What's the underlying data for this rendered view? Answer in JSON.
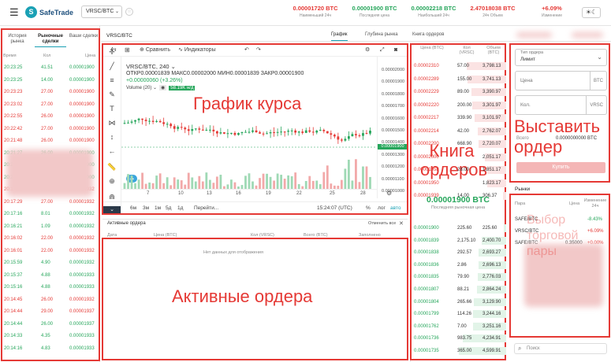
{
  "header": {
    "menu_icon": "☰",
    "logo_mark": "S",
    "logo_text": "SafeTrade",
    "pair": "VRSC/BTC",
    "chev": "⌄",
    "star": "☆",
    "theme_icon": "☀☾",
    "stats": [
      {
        "value": "0.00001720 BTC",
        "label": "Наименьший 24ч",
        "color": "#e53935"
      },
      {
        "value": "0.00001900 BTC",
        "label": "Последняя цена",
        "color": "#26a65b"
      },
      {
        "value": "0.00002218 BTC",
        "label": "Наибольший 24ч",
        "color": "#26a65b"
      },
      {
        "value": "2.47018038 BTC",
        "label": "24ч Объем",
        "color": "#e53935"
      },
      {
        "value": "+6.09%",
        "label": "Изменение",
        "color": "#e53935"
      }
    ]
  },
  "subheader": {
    "pair": "VRSC/BTC",
    "tabs": [
      "График",
      "Глубина рынка",
      "Книга ордеров"
    ]
  },
  "left": {
    "tabs": [
      "История рынка",
      "Рыночные сделки",
      "Ваши сделки"
    ],
    "cols": [
      "Время",
      "Кол",
      "Цена"
    ],
    "rows": [
      [
        "20:23:25",
        "41.51",
        "0.00001900",
        "g"
      ],
      [
        "20:23:25",
        "14.00",
        "0.00001900",
        "g"
      ],
      [
        "20:23:23",
        "27.00",
        "0.00001900",
        "r"
      ],
      [
        "20:23:02",
        "27.00",
        "0.00001900",
        "r"
      ],
      [
        "20:22:55",
        "26.00",
        "0.00001900",
        "r"
      ],
      [
        "20:22:42",
        "27.00",
        "0.00001900",
        "r"
      ],
      [
        "20:21:48",
        "26.00",
        "0.00001900",
        "r"
      ],
      [
        "20:21:27",
        "26.00",
        "0.00001900",
        "g"
      ],
      [
        "20:21:09",
        "26.00",
        "0.00001900",
        "g"
      ],
      [
        "20:20:59",
        "26.00",
        "0.00001900",
        "g"
      ],
      [
        "20:17:30",
        "27.00",
        "0.00001932",
        "r"
      ],
      [
        "20:17:29",
        "27.00",
        "0.00001932",
        "r"
      ],
      [
        "20:17:16",
        "8.01",
        "0.00001932",
        "g"
      ],
      [
        "20:16:21",
        "1.09",
        "0.00001932",
        "g"
      ],
      [
        "20:16:02",
        "22.00",
        "0.00001932",
        "r"
      ],
      [
        "20:16:01",
        "22.00",
        "0.00001932",
        "r"
      ],
      [
        "20:15:59",
        "4.90",
        "0.00001932",
        "g"
      ],
      [
        "20:15:37",
        "4.88",
        "0.00001933",
        "g"
      ],
      [
        "20:15:16",
        "4.88",
        "0.00001933",
        "g"
      ],
      [
        "20:14:45",
        "26.00",
        "0.00001932",
        "r"
      ],
      [
        "20:14:44",
        "29.00",
        "0.00001937",
        "r"
      ],
      [
        "20:14:44",
        "26.00",
        "0.00001937",
        "g"
      ],
      [
        "20:14:33",
        "4.35",
        "0.00001933",
        "g"
      ],
      [
        "20:14:16",
        "4.83",
        "0.00001933",
        "g"
      ]
    ],
    "overlay_text": "История сделок"
  },
  "chart": {
    "interval": "4ч",
    "compare": "Сравнить",
    "indicators": "Индикаторы",
    "undo": "↶",
    "redo": "↷",
    "legend_title": "VRSC/BTC, 240 ⌄",
    "legend_ohlc": "ОТКР0.00001839 МАКС0.00002000 МИН0.00001839 ЗАКР0.00001900",
    "legend_change": "+0.00000060 (+3.26%)",
    "vol_label": "Volume (20) ⌄",
    "vol_value": "58.19K н/д",
    "y_ticks": [
      "0.00002000",
      "0.00001900",
      "0.00001800",
      "0.00001700",
      "0.00001600",
      "0.00001500",
      "0.00001400",
      "0.00001300",
      "0.00001200",
      "0.00001100",
      "0.00001000"
    ],
    "last_tag": "0.00001900",
    "x_ticks": [
      "7",
      "10",
      "13",
      "16",
      "19",
      "22",
      "25",
      "28"
    ],
    "ranges": [
      "6м",
      "3м",
      "1м",
      "5д",
      "1д",
      "Перейти..."
    ],
    "time": "15:24:07 (UTC)",
    "pct": "%",
    "log": "лог",
    "auto": "авто",
    "overlay_label": "График курса"
  },
  "orders": {
    "title": "Активные ордера",
    "cancel_all": "Отменить все",
    "close": "✕",
    "cols": [
      "Дата",
      "Цена (BTC)",
      "Кол (VRSC)",
      "Всего (BTC)",
      "Заполнено"
    ],
    "empty": "Нет данных для отображения",
    "overlay_label": "Активные ордера"
  },
  "book": {
    "cols": [
      "Цена (BTC)",
      "Кол (VRSC)",
      "Объем (BTC)"
    ],
    "asks": [
      [
        "0.00002310",
        "57.00",
        "3,798.13"
      ],
      [
        "0.00002289",
        "155.00",
        "3,741.13"
      ],
      [
        "0.00002229",
        "89.00",
        "3,390.97"
      ],
      [
        "0.00002220",
        "200.00",
        "3,301.97"
      ],
      [
        "0.00002217",
        "339.90",
        "3,101.97"
      ],
      [
        "0.00002214",
        "42.00",
        "2,762.07"
      ],
      [
        "0.00002200",
        "668.90",
        "2,720.07"
      ],
      [
        "0.00002000",
        "",
        "2,051.17"
      ],
      [
        "0.00001958",
        "28.00",
        "1,851.17"
      ],
      [
        "0.00001950",
        "",
        "1,823.17"
      ],
      [
        "0.00001939",
        "14.00",
        "306.37"
      ]
    ],
    "last_price": "0.00001900 BTC",
    "last_label": "Последняя рыночная цена",
    "bids": [
      [
        "0.00001900",
        "225.60",
        "225.60"
      ],
      [
        "0.00001839",
        "2,175.10",
        "2,400.70"
      ],
      [
        "0.00001838",
        "292.57",
        "2,693.27"
      ],
      [
        "0.00001836",
        "2.86",
        "2,696.13"
      ],
      [
        "0.00001835",
        "79.90",
        "2,776.03"
      ],
      [
        "0.00001807",
        "88.21",
        "2,864.24"
      ],
      [
        "0.00001804",
        "265.66",
        "3,129.90"
      ],
      [
        "0.00001799",
        "114.26",
        "3,244.16"
      ],
      [
        "0.00001762",
        "7.00",
        "3,251.16"
      ],
      [
        "0.00001736",
        "983.75",
        "4,234.91"
      ],
      [
        "0.00001735",
        "365.00",
        "4,599.91"
      ]
    ],
    "overlay_label": "Книга ордеров"
  },
  "place": {
    "type_label": "Тип ордера",
    "type_value": "Лимит",
    "price_label": "Цена",
    "price_unit": "BTC",
    "qty_label": "Кол.",
    "qty_unit": "VRSC",
    "total_label": "Всего",
    "total_value": "0.0000000000 BTC",
    "buy": "Купить",
    "overlay_label": "Выставить ордер"
  },
  "markets": {
    "title": "Рынки",
    "cols": [
      "Пара",
      "Цена",
      "Изменение 24ч"
    ],
    "rows": [
      [
        "SAFE/BTC",
        "",
        "-8.43%",
        "g"
      ],
      [
        "VRSC/BTC",
        "",
        "+6.09%",
        "r"
      ],
      [
        "SAFE/BTC",
        "0.35000",
        "+0.00%",
        "r"
      ]
    ],
    "search": "Поиск",
    "overlay_label": "Выбор торговой пары"
  }
}
